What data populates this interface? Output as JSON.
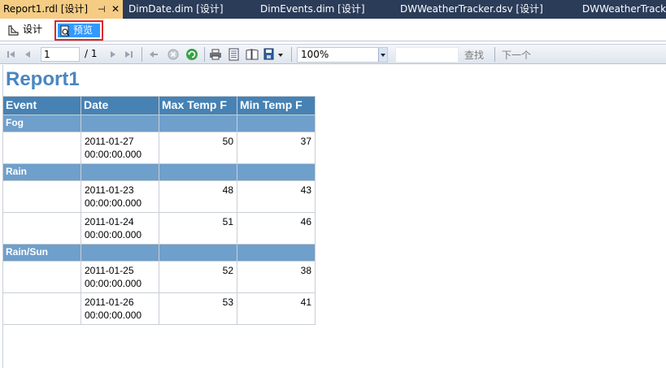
{
  "doc_tabs": [
    {
      "label": "Report1.rdl [设计]",
      "active": true
    },
    {
      "label": "DimDate.dim [设计]",
      "active": false
    },
    {
      "label": "DimEvents.dim [设计]",
      "active": false
    },
    {
      "label": "DWWeatherTracker.dsv [设计]",
      "active": false
    },
    {
      "label": "DWWeatherTrack",
      "active": false
    }
  ],
  "doc_tab_glyphs": {
    "pin": "⊣",
    "close": "✕"
  },
  "view_tabs": {
    "design": "设计",
    "preview": "预览"
  },
  "toolbar": {
    "page_current": "1",
    "page_total": "/ 1",
    "zoom": "100%",
    "find_label": "查找",
    "next_label": "下一个",
    "icons": [
      "first-page-icon",
      "previous-page-icon",
      "next-page-icon",
      "last-page-icon",
      "back-icon",
      "stop-icon",
      "refresh-icon",
      "print-icon",
      "print-layout-icon",
      "page-setup-icon",
      "export-icon"
    ]
  },
  "report": {
    "title": "Report1",
    "columns": [
      "Event",
      "Date",
      "Max Temp F",
      "Min Temp F"
    ],
    "groups": [
      {
        "name": "Fog",
        "rows": [
          {
            "date": "2011-01-27 00:00:00.000",
            "max": "50",
            "min": "37"
          }
        ]
      },
      {
        "name": "Rain",
        "rows": [
          {
            "date": "2011-01-23 00:00:00.000",
            "max": "48",
            "min": "43"
          },
          {
            "date": "2011-01-24 00:00:00.000",
            "max": "51",
            "min": "46"
          }
        ]
      },
      {
        "name": "Rain/Sun",
        "rows": [
          {
            "date": "2011-01-25 00:00:00.000",
            "max": "52",
            "min": "38"
          },
          {
            "date": "2011-01-26 00:00:00.000",
            "max": "53",
            "min": "41"
          }
        ]
      }
    ]
  },
  "colors": {
    "tabstrip": "#2b3c59",
    "active_tab": "#f5cc84",
    "preview_highlight": "#3399ff",
    "preview_outline": "#e0262c",
    "title": "#4a86c1",
    "header": "#4682b4",
    "group": "#6f9fcb"
  }
}
